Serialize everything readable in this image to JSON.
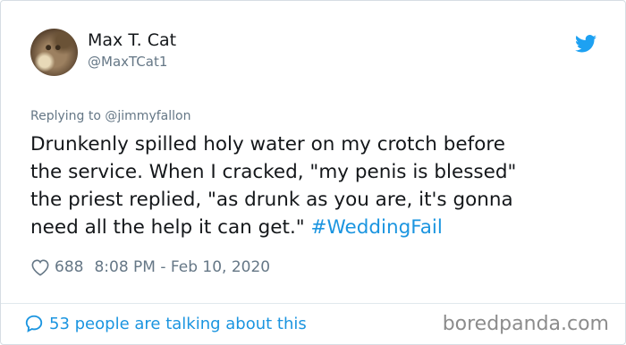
{
  "author": {
    "name": "Max T. Cat",
    "handle": "@MaxTCat1"
  },
  "reply": {
    "prefix": "Replying to ",
    "mention": "@jimmyfallon"
  },
  "tweet": {
    "lines": [
      "Drunkenly spilled holy water on my crotch before",
      "the service. When I cracked, \"my penis is blessed\"",
      "the priest replied, \"as drunk as you are, it's gonna",
      "need all the help it can get.\" "
    ],
    "hashtag": "#WeddingFail"
  },
  "meta": {
    "likes": "688",
    "timestamp": "8:08 PM - Feb 10, 2020"
  },
  "footer": {
    "talking": "53 people are talking about this",
    "watermark": "boredpanda.com"
  },
  "icons": {
    "brand": "twitter-bird-icon",
    "like": "heart-icon",
    "comment": "speech-bubble-icon"
  },
  "colors": {
    "twitter_blue": "#1b95e0",
    "muted": "#657786",
    "text": "#14171a"
  }
}
